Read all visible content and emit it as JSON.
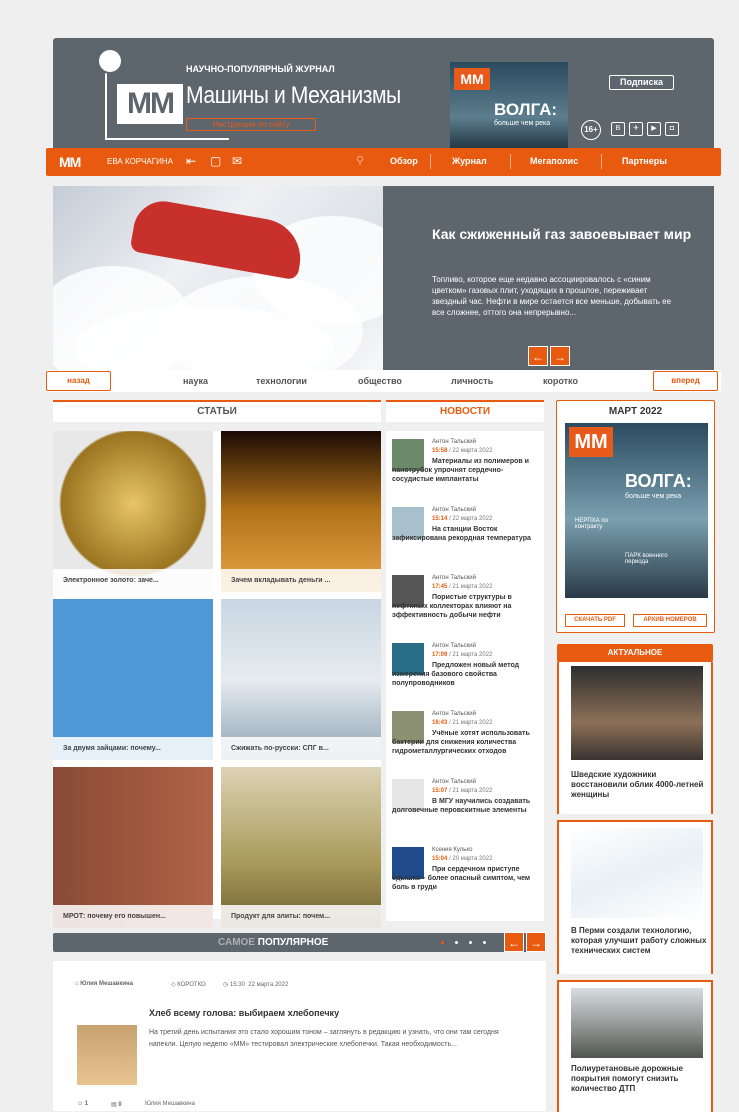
{
  "header": {
    "subtitle": "НАУЧНО-ПОПУЛЯРНЫЙ ЖУРНАЛ",
    "title": "Машины и Механизмы",
    "logo": "ММ",
    "instruction_btn": "Инструкция по сайту",
    "cover_title": "ВОЛГА:",
    "cover_sub": "больше чем река",
    "subscribe": "Подписка",
    "age": "16+",
    "social": [
      "В",
      "✈",
      "▶",
      "◘"
    ]
  },
  "nav": {
    "logo": "ММ",
    "user": "ЕВА КОРЧАГИНА",
    "links": [
      "Обзор",
      "Журнал",
      "Мегаполис",
      "Партнеры"
    ]
  },
  "hero": {
    "title": "Как сжиженный газ завоевывает мир",
    "text": "Топливо, которое еще недавно ассоциировалось с «синим цветком» газовых плит, уходящих в прошлое, переживает звездный час. Нефти в мире остается все меньше, добывать ее все сложнее, оттого она непрерывно..."
  },
  "cats": {
    "back": "назад",
    "forward": "вперед",
    "items": [
      "наука",
      "технологии",
      "общество",
      "личность",
      "коротко"
    ]
  },
  "sections": {
    "articles": "СТАТЬИ",
    "news": "НОВОСТИ"
  },
  "articles": [
    {
      "caption": "Электронное золото: заче..."
    },
    {
      "caption": "Зачем вкладывать деньги ..."
    },
    {
      "caption": "За двумя зайцами: почему..."
    },
    {
      "caption": "Сжижать по-русски: СПГ в..."
    },
    {
      "caption": "МРОТ: почему его повышен..."
    },
    {
      "caption": "Продукт для элиты: почем..."
    }
  ],
  "news": [
    {
      "author": "Антон Тальский",
      "time": "15:58",
      "date": "/ 22 марта 2022",
      "title": "Материалы из полимеров и нанотрубок упрочнят сердечно-сосудистые имплантаты"
    },
    {
      "author": "Антон Тальский",
      "time": "15:14",
      "date": "/ 22 марта 2022",
      "title": "На станции Восток зафиксирована рекордная температура"
    },
    {
      "author": "Антон Тальский",
      "time": "17:45",
      "date": "/ 21 марта 2022",
      "title": "Пористые структуры в нефтяных коллекторах влияют на эффективность добычи нефти"
    },
    {
      "author": "Антон Тальский",
      "time": "17:09",
      "date": "/ 21 марта 2022",
      "title": "Предложен новый метод измерения базового свойства полупроводников"
    },
    {
      "author": "Антон Тальский",
      "time": "16:43",
      "date": "/ 21 марта 2022",
      "title": "Учёные хотят использовать бактерии для снижения количества гидрометаллургических отходов"
    },
    {
      "author": "Антон Тальский",
      "time": "15:07",
      "date": "/ 21 марта 2022",
      "title": "В МГУ научились создавать долговечные перовскитные элементы"
    },
    {
      "author": "Ксения Кулько",
      "time": "15:04",
      "date": "/ 20 марта 2022",
      "title": "При сердечном приступе одышка – более опасный симптом, чем боль в груди"
    }
  ],
  "magazine": {
    "title": "МАРТ 2022",
    "cover_title": "ВОЛГА:",
    "cover_sub": "больше чем река",
    "cover_line1": "НЕРПХА по контракту",
    "cover_line2": "ПАРК военного периода",
    "download": "СКАЧАТЬ PDF",
    "archive": "АРХИВ НОМЕРОВ"
  },
  "actual": {
    "title": "АКТУАЛЬНОЕ",
    "items": [
      {
        "title": "Шведские художники восстановили облик 4000-летней женщины"
      },
      {
        "title": "В Перми создали технологию, которая улучшит работу сложных технических систем"
      },
      {
        "title": "Полиуретановые дорожные покрытия помогут снизить количество ДТП"
      }
    ]
  },
  "popular": {
    "title_light": "САМОЕ ",
    "title_bold": "ПОПУЛЯРНОЕ"
  },
  "post": {
    "author": "Юлия Мешавкина",
    "tag": "КОРОТКО",
    "time": "15:30",
    "date": "22 марта 2022",
    "title": "Хлеб всему голова: выбираем хлебопечку",
    "text": "На третий день испытания это стало хорошим тоном – заглянуть в редакцию и узнать, что они там сегодня напекли. Целую неделю «ММ» тестировал электрические хлебопечки. Такая необходимость...",
    "likes": "1",
    "comments": "0",
    "author2": "Юлия Мешавкина"
  },
  "colors": {
    "accent": "#e85a0f",
    "header_bg": "#5d666d"
  }
}
